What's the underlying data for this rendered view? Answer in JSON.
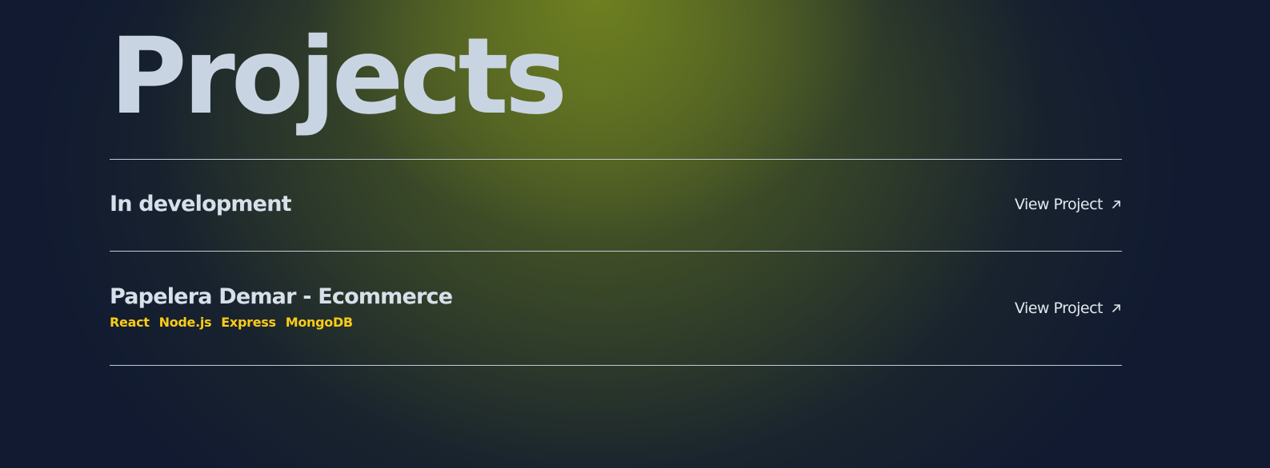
{
  "section": {
    "title": "Projects"
  },
  "projects": [
    {
      "name": "In development",
      "link_label": "View Project",
      "tags": []
    },
    {
      "name": "Papelera Demar - Ecommerce",
      "link_label": "View Project",
      "tags": [
        "React",
        "Node.js",
        "Express",
        "MongoDB"
      ]
    }
  ],
  "icons": {
    "link_icon": "arrow-up-right-icon"
  },
  "colors": {
    "background": "#111a30",
    "glow": "#708220",
    "text": "#cbd5e1",
    "tag": "#facc15",
    "divider": "#c2cad6"
  }
}
